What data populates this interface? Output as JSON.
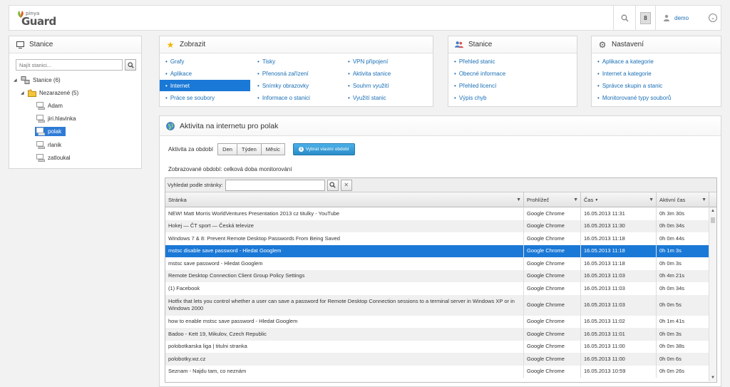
{
  "header": {
    "logo_top": "pinya",
    "logo_main": "Guard",
    "notification_count": "8",
    "user": "demo"
  },
  "stanice_panel": {
    "title": "Stanice",
    "search_placeholder": "Najít stanici...",
    "tree": [
      {
        "label": "Stanice (6)"
      },
      {
        "label": "Nezarazené (5)"
      },
      {
        "label": "Adam"
      },
      {
        "label": "jiri.hlavinka"
      },
      {
        "label": "polak"
      },
      {
        "label": "rlanik"
      },
      {
        "label": "zatloukal"
      }
    ]
  },
  "zobrazit": {
    "title": "Zobrazit",
    "col1": [
      "Grafy",
      "Aplikace",
      "Internet",
      "Práce se soubory"
    ],
    "col2": [
      "Tisky",
      "Přenosná zařízení",
      "Snímky obrazovky",
      "Informace o stanici"
    ],
    "col3": [
      "VPN připojení",
      "Aktivita stanice",
      "Souhrn využití",
      "Využití stanic"
    ]
  },
  "stanice_menu": {
    "title": "Stanice",
    "items": [
      "Přehled stanic",
      "Obecné informace",
      "Přehled licencí",
      "Výpis chyb"
    ]
  },
  "nastaveni": {
    "title": "Nastavení",
    "items": [
      "Aplikace a kategorie",
      "Internet a kategorie",
      "Správce skupin a stanic",
      "Monitorované typy souborů"
    ]
  },
  "activity": {
    "title": "Aktivita na internetu pro polak",
    "period_label": "Aktivita za období",
    "period_buttons": [
      "Den",
      "Týden",
      "Měsíc"
    ],
    "custom_period": "Vybrat vlastní období",
    "shown_period": "Zobrazované období: celková doba monitorování",
    "search_label": "Vyhledat podle stránky:",
    "columns": [
      "Stránka",
      "Prohlížeč",
      "Čas",
      "Aktivní čas"
    ],
    "rows": [
      {
        "page": "NEW! Matt Morris WorldVentures Presentation 2013 cz titulky - YouTube",
        "browser": "Google Chrome",
        "time": "16.05.2013 11:31",
        "active": "0h 3m 30s"
      },
      {
        "page": "Hokej — ČT sport — Česká televize",
        "browser": "Google Chrome",
        "time": "16.05.2013 11:30",
        "active": "0h 0m 34s"
      },
      {
        "page": "Windows 7 & 8: Prevent Remote Desktop Passwords From Being Saved",
        "browser": "Google Chrome",
        "time": "16.05.2013 11:18",
        "active": "0h 0m 44s"
      },
      {
        "page": "mstsc disable save password - Hledat Googlem",
        "browser": "Google Chrome",
        "time": "16.05.2013 11:18",
        "active": "0h 1m 3s"
      },
      {
        "page": "mstsc save password - Hledat Googlem",
        "browser": "Google Chrome",
        "time": "16.05.2013 11:18",
        "active": "0h 0m 3s"
      },
      {
        "page": "Remote Desktop Connection Client Group Policy Settings",
        "browser": "Google Chrome",
        "time": "16.05.2013 11:03",
        "active": "0h 4m 21s"
      },
      {
        "page": "(1) Facebook",
        "browser": "Google Chrome",
        "time": "16.05.2013 11:03",
        "active": "0h 0m 34s"
      },
      {
        "page": "Hotfix that lets you control whether a user can save a password for Remote Desktop Connection sessions to a terminal server in Windows XP or in Windows 2000",
        "browser": "Google Chrome",
        "time": "16.05.2013 11:03",
        "active": "0h 0m 5s"
      },
      {
        "page": "how to enable mstsc save password - Hledat Googlem",
        "browser": "Google Chrome",
        "time": "16.05.2013 11:02",
        "active": "0h 1m 41s"
      },
      {
        "page": "Badoo - Kett 19, Mikulov, Czech Republic",
        "browser": "Google Chrome",
        "time": "16.05.2013 11:01",
        "active": "0h 0m 3s"
      },
      {
        "page": "polobotkarska liga | titulni stranka",
        "browser": "Google Chrome",
        "time": "16.05.2013 11:00",
        "active": "0h 0m 38s"
      },
      {
        "page": "polobotky.wz.cz",
        "browser": "Google Chrome",
        "time": "16.05.2013 11:00",
        "active": "0h 0m 6s"
      },
      {
        "page": "Seznam - Najdu tam, co neznám",
        "browser": "Google Chrome",
        "time": "16.05.2013 10:59",
        "active": "0h 0m 26s"
      }
    ]
  },
  "colors": {
    "accent": "#1a78d6",
    "link": "#1a6fb5"
  }
}
